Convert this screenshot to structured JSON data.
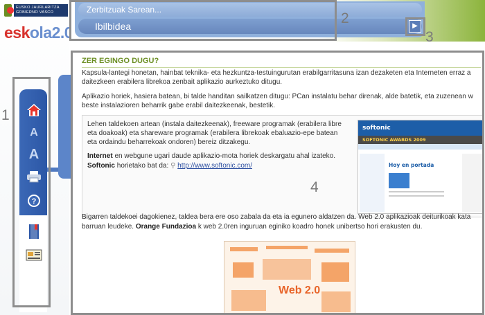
{
  "header": {
    "gov_logo_text": "EUSKO JAURLARITZA GOBIERNO VASCO",
    "brand_part1": "esk",
    "brand_part2": "ola",
    "brand_version": "2.0",
    "breadcrumb_top": "Zerbitzuak Sarean...",
    "breadcrumb_current": "Ibilbidea"
  },
  "annotations": [
    "1",
    "2",
    "3",
    "4"
  ],
  "toolbar": {
    "icons": [
      "home-icon",
      "font-increase-icon",
      "font-decrease-icon",
      "print-icon",
      "help-icon",
      "book-icon",
      "certificate-icon"
    ],
    "font_larger": "A",
    "font_smaller": "A"
  },
  "content": {
    "title": "ZER EGINGO DUGU?",
    "p1_line1": "Kapsula-lantegi honetan, hainbat teknika- eta hezkuntza-testuingurutan erabilgarritasuna izan dezaketen eta Interneten erraz a",
    "p1_line2": "daitezkeen erabilera librekoa zenbait aplikazio aurkeztuko ditugu.",
    "p2_line1": "Aplikazio horiek, hasiera batean, bi talde handitan sailkatzen ditugu: PCan instalatu behar direnak, alde batetik, eta zuzenean w",
    "p2_line2": "beste instalazioren beharrik gabe erabil daitezkeenak, bestetik.",
    "box_line1": "Lehen taldekoen artean (instala daitezkeenak), freeware programak (erabilera libre",
    "box_line2": "eta doakoak) eta shareware programak (erabilera librekoak ebaluazio-epe batean",
    "box_line3": "eta ordaindu beharrekoak ondoren) bereiz ditzakegu.",
    "internet_bold": "Internet",
    "internet_rest": " en webgune ugari daude aplikazio-mota horiek deskargatu ahal izateko.",
    "softonic_bold": "Softonic",
    "softonic_rest": " horietako bat da: ",
    "softonic_link": "http://www.softonic.com/",
    "p3_line1": "Bigarren taldekoei dagokienez, taldea bera ere oso zabala da eta ia egunero aldatzen da. Web 2.0 aplikazioak deiturikoak kata",
    "p3_line2_a": "barruan leudeke. ",
    "orange_bold": "Orange Fundazioa",
    "p3_line2_b": " k web 2.0ren inguruan eginiko koadro honek unibertso hori erakusten du."
  },
  "softonic_shot": {
    "logo": "softonic",
    "awards": "SOFTONIC AWARDS 2009",
    "heading": "Hoy en portada"
  },
  "web20_shot": {
    "label": "Web 2.0"
  }
}
